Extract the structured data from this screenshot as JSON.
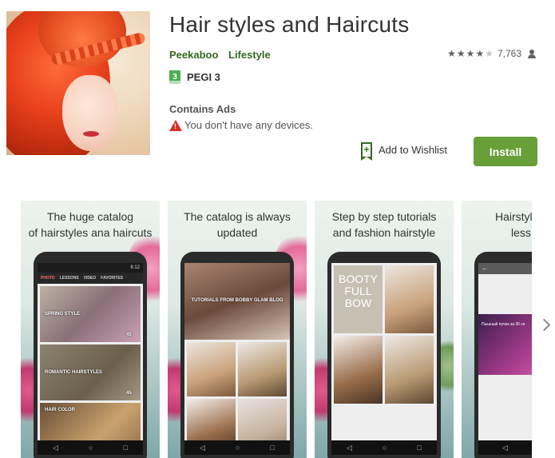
{
  "app": {
    "title": "Hair styles and Haircuts",
    "developer": "Peekaboo",
    "category": "Lifestyle",
    "rating_value": 4.5,
    "rating_count": "7,763",
    "pegi_label": "PEGI 3",
    "pegi_number": "3",
    "contains_ads": "Contains Ads",
    "device_warning": "You don't have any devices.",
    "wishlist_label": "Add to Wishlist",
    "install_label": "Install"
  },
  "colors": {
    "install_button": "#689f38",
    "developer_link": "#33691e",
    "warning": "#d93025",
    "pegi_badge": "#4caf50"
  },
  "screenshots": [
    {
      "caption_line1": "The huge catalog",
      "caption_line2": "of hairstyles ana haircuts",
      "status_time": "6:12",
      "tabs": [
        "PHOTO",
        "LESSONS",
        "VIDEO",
        "FAVORITES"
      ],
      "cards": [
        "SPRING STYLE",
        "ROMANTIC HAIRSTYLES",
        "HAIR COLOR"
      ],
      "counts": [
        "45",
        "45"
      ]
    },
    {
      "caption_line1": "The catalog is always",
      "caption_line2": "updated",
      "hero_label": "TUTORIALS FROM BOBBY GLAM BLOG"
    },
    {
      "caption_line1": "Step by step tutorials",
      "caption_line2": "and fashion hairstyle",
      "booty_text_1": "BOOTY",
      "booty_text_2": "FULL",
      "booty_text_3": "BOW"
    },
    {
      "caption_line1": "Hairstyl",
      "caption_line2": "less",
      "card_label": "Пышный пучок за 30 се"
    }
  ],
  "nav_glyphs": {
    "back": "◁",
    "home": "○",
    "recents": "□"
  }
}
